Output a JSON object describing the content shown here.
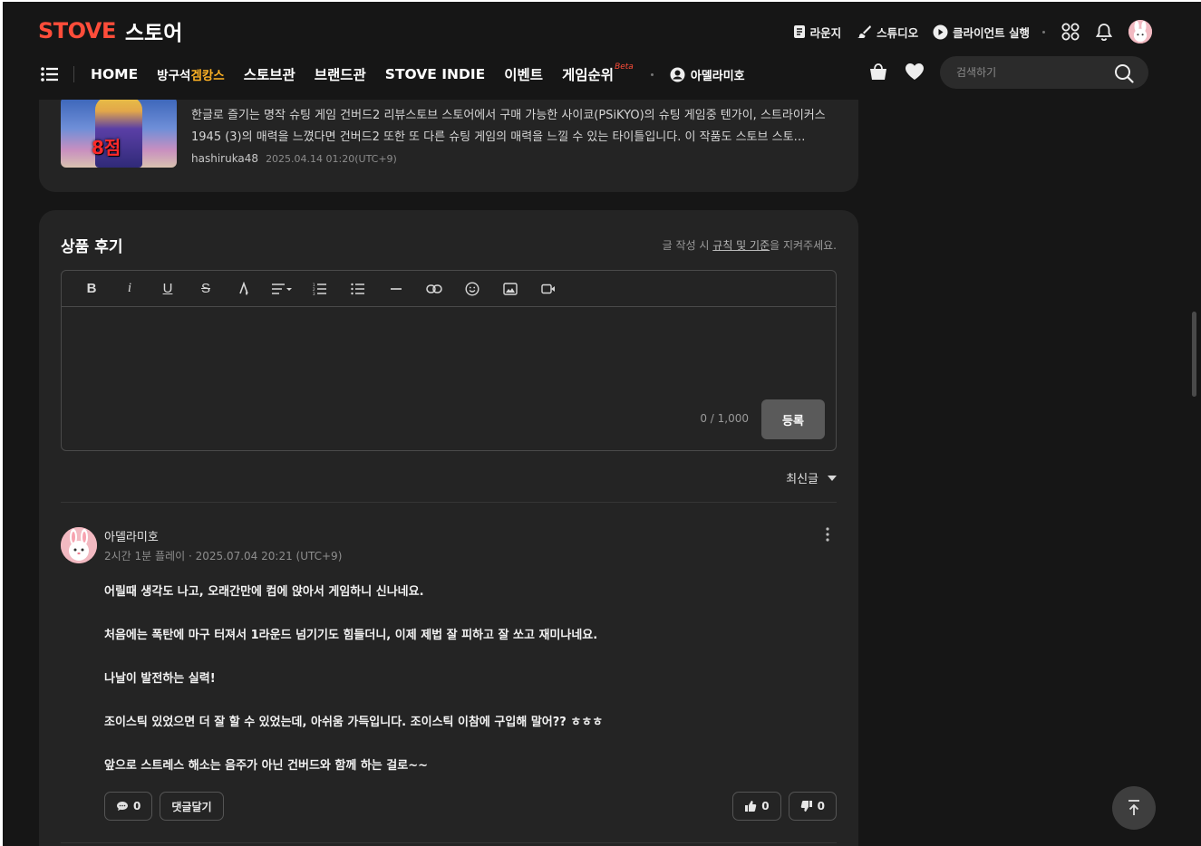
{
  "header": {
    "logo_brand": "STOVE",
    "logo_store": "스토어",
    "util": {
      "lounge": "라운지",
      "studio": "스튜디오",
      "client": "클라이언트 실행"
    },
    "nav": {
      "home": "HOME",
      "gemcamps_prefix": "방구석",
      "gemcamps_highlight": "겜캉스",
      "stove_hall": "스토브관",
      "brand_hall": "브랜드관",
      "indie": "STOVE INDIE",
      "event": "이벤트",
      "ranking": "게임순위",
      "ranking_badge": "Beta",
      "user": "아델라미호"
    },
    "search": {
      "placeholder": "검색하기"
    }
  },
  "top_review": {
    "score_overlay": "8점",
    "text": "한글로 즐기는 명작 슈팅 게임 건버드2 리뷰스토브 스토어에서 구매 가능한 사이쿄(PSiKYO)의 슈팅 게임중 텐가이, 스트라이커스 1945 (3)의 매력을 느꼈다면  건버드2 또한 또 다른 슈팅 게임의 매력을 느낄 수 있는 타이틀입니다. 이 작품도 스토브 스토…",
    "author": "hashiruka48",
    "date": "2025.04.14 01:20(UTC+9)"
  },
  "review_section": {
    "title": "상품 후기",
    "rules_prefix": "글 작성 시 ",
    "rules_link": "규칙 및 기준",
    "rules_suffix": "을 지켜주세요.",
    "counter": "0 / 1,000",
    "submit": "등록",
    "sort": "최신글"
  },
  "review": {
    "author": "아델라미호",
    "playtime": "2시간 1분 플레이",
    "date": "2025.07.04 20:21 (UTC+9)",
    "lines": [
      "어릴때 생각도 나고, 오래간만에 컴에 앉아서 게임하니 신나네요.",
      "처음에는 폭탄에 마구 터져서 1라운드 넘기기도 힘들더니, 이제 제법 잘 피하고 잘 쏘고 재미나네요.",
      "나날이 발전하는 실력!",
      "조이스틱 있었으면 더 잘 할 수 있었는데, 아쉬움 가득입니다. 조이스틱 이참에 구입해 말어?? ㅎㅎㅎ",
      "앞으로 스트레스 해소는 음주가 아닌 건버드와 함께 하는 걸로~~"
    ],
    "comment_count": "0",
    "reply_label": "댓글달기",
    "like_count": "0",
    "dislike_count": "0"
  },
  "colors": {
    "background": "#161616",
    "card": "#242424",
    "brand": "#ff4d3a",
    "highlight": "#ffb224"
  }
}
